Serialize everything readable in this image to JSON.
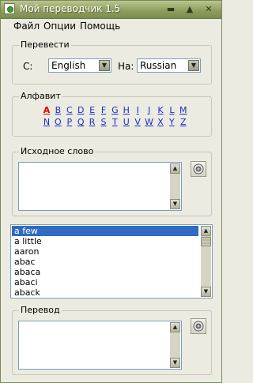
{
  "window": {
    "title": "Мой переводчик 1.5"
  },
  "titlebar_buttons": [
    {
      "name": "minimize-button",
      "glyph": "▬"
    },
    {
      "name": "maximize-button",
      "glyph": "▲"
    },
    {
      "name": "close-button",
      "glyph": "✕"
    }
  ],
  "menu": {
    "file": "Файл",
    "options": "Опции",
    "help": "Помощь"
  },
  "translate": {
    "title": "Перевести",
    "from_label": "С:",
    "from_value": "English",
    "to_label": "На:",
    "to_value": "Russian"
  },
  "alphabet": {
    "title": "Алфавит",
    "selected": "A",
    "row1": [
      "A",
      "B",
      "C",
      "D",
      "E",
      "F",
      "G",
      "H",
      "I",
      "J",
      "K",
      "L",
      "M"
    ],
    "row2": [
      "N",
      "O",
      "P",
      "Q",
      "R",
      "S",
      "T",
      "U",
      "V",
      "W",
      "X",
      "Y",
      "Z"
    ]
  },
  "source": {
    "title": "Исходное слово",
    "value": ""
  },
  "wordlist": {
    "items": [
      "a few",
      "a little",
      "aaron",
      "abac",
      "abaca",
      "abaci",
      "aback"
    ],
    "selected_index": 0
  },
  "result": {
    "title": "Перевод",
    "value": ""
  },
  "icons": {
    "speaker": "speaker-icon"
  },
  "colors": {
    "selection": "#316ac5",
    "link": "#1a2ec6",
    "active_letter": "#e00000"
  }
}
